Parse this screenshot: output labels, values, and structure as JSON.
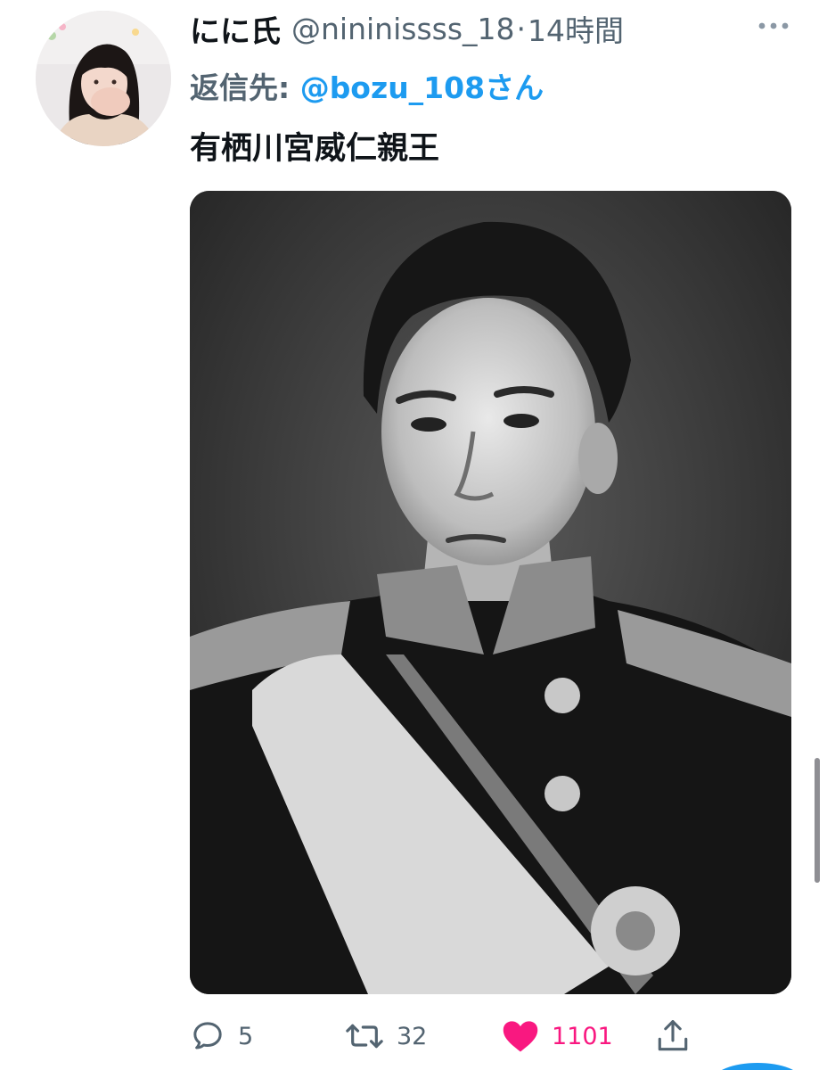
{
  "tweet": {
    "display_name": "にに氏",
    "handle": "@nininissss_18",
    "separator": "·",
    "time": "14時間",
    "reply_prefix": "返信先: ",
    "reply_mention": "@bozu_108さん",
    "text": "有栖川宮威仁親王"
  },
  "actions": {
    "reply_count": "5",
    "retweet_count": "32",
    "like_count": "1101"
  },
  "icons": {
    "more": "more-horizontal-icon",
    "reply": "speech-bubble-icon",
    "retweet": "retweet-arrows-icon",
    "like": "heart-icon",
    "share": "share-upload-icon"
  },
  "colors": {
    "link": "#1d9bf0",
    "like_active": "#f91880",
    "secondary_text": "#536471",
    "primary_text": "#0f1419"
  }
}
